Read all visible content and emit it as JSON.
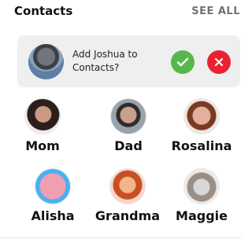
{
  "header": {
    "title": "Contacts",
    "see_all": "SEE ALL"
  },
  "suggestion": {
    "text": "Add Joshua to Contacts?",
    "accept_icon": "check-icon",
    "decline_icon": "close-icon"
  },
  "contacts": [
    {
      "name": "Mom"
    },
    {
      "name": "Dad"
    },
    {
      "name": "Rosalina"
    },
    {
      "name": "Alisha"
    },
    {
      "name": "Grandma"
    },
    {
      "name": "Maggie"
    }
  ],
  "colors": {
    "accept": "#56b84a",
    "decline": "#ea2230",
    "card_bg": "#efefef",
    "see_all": "#6f7278"
  }
}
